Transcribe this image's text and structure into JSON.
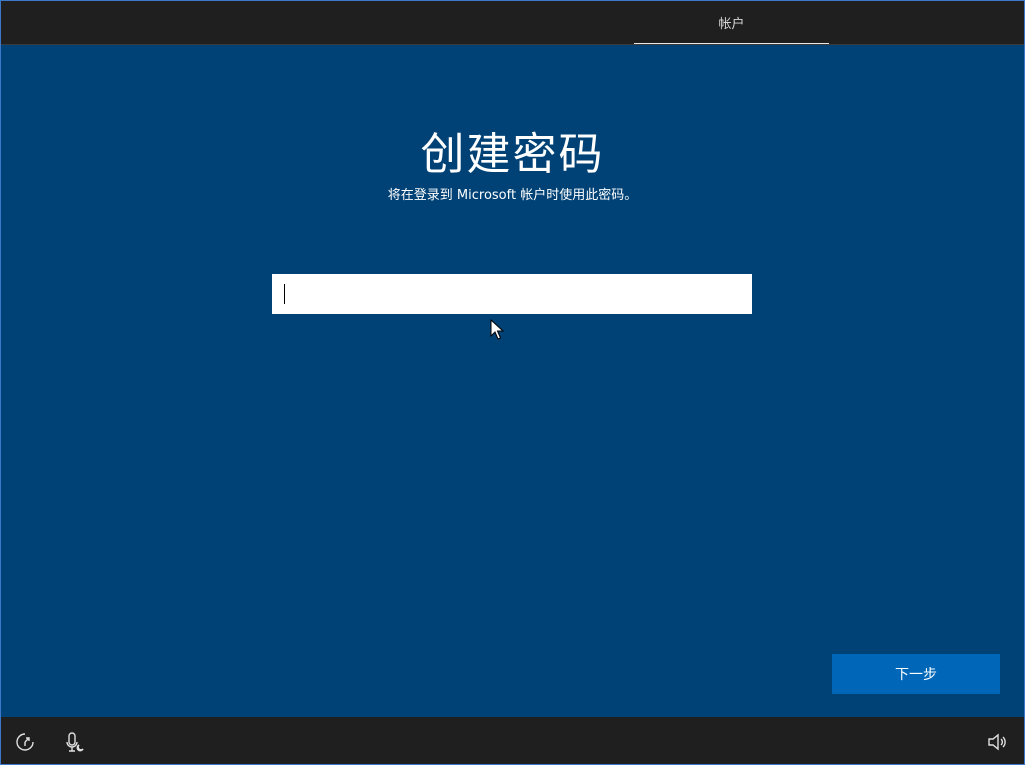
{
  "topbar": {
    "tabs": [
      {
        "label": "帐户",
        "active": true
      }
    ]
  },
  "main": {
    "title": "创建密码",
    "subtitle": "将在登录到 Microsoft 帐户时使用此密码。",
    "password_input": {
      "value": "",
      "placeholder": ""
    },
    "next_label": "下一步"
  },
  "bottombar": {
    "icons": [
      "ease-of-access-icon",
      "microphone-icon",
      "volume-icon"
    ]
  },
  "colors": {
    "background": "#004275",
    "bar": "#1f1f1f",
    "button": "#0067b8",
    "text": "#ffffff"
  }
}
